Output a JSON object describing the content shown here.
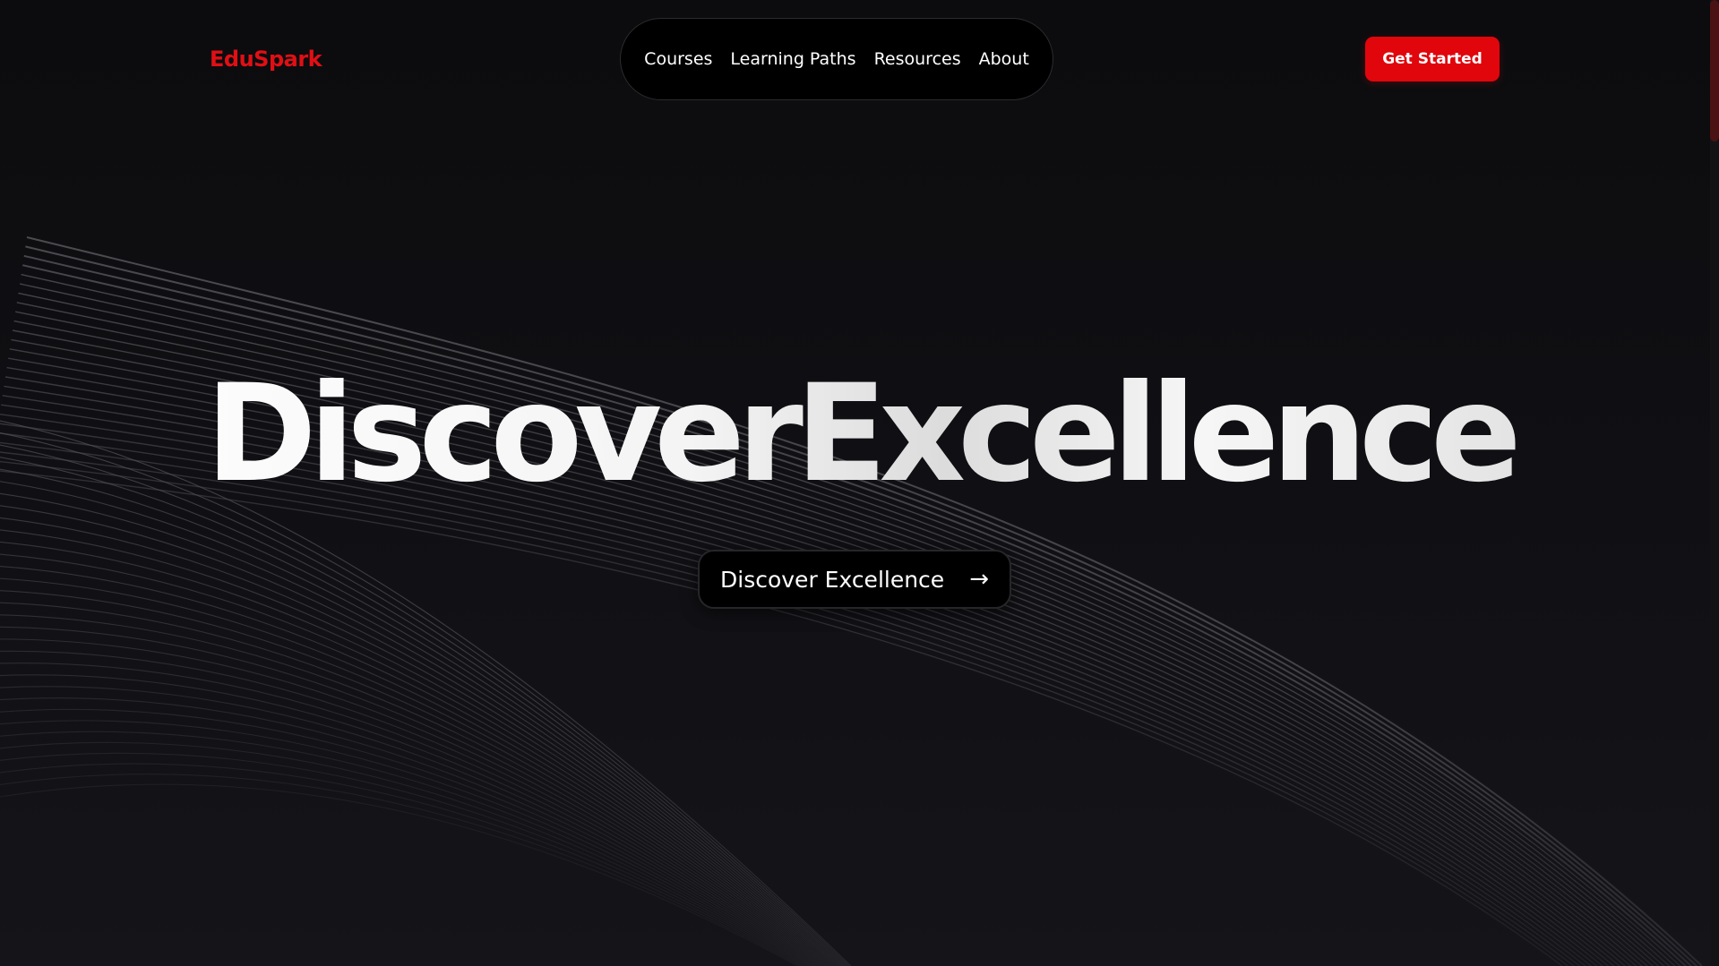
{
  "header": {
    "logo": "EduSpark",
    "nav": [
      "Courses",
      "Learning Paths",
      "Resources",
      "About"
    ],
    "cta_label": "Get Started"
  },
  "hero": {
    "title": "DiscoverExcellence",
    "button_label": "Discover Excellence",
    "button_icon": "→"
  },
  "colors": {
    "brand": "#e10f14",
    "cta": "#e0060c",
    "background": "#0d0d10",
    "wave_line": "#5a5a60"
  },
  "icons": [
    "arrow-right-icon"
  ]
}
